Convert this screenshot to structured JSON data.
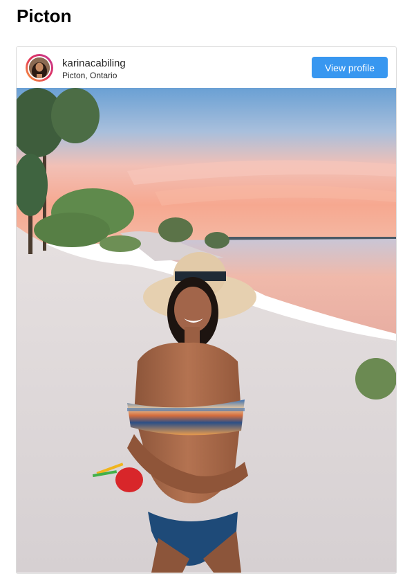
{
  "page": {
    "title": "Picton"
  },
  "post": {
    "username": "karinacabiling",
    "location": "Picton, Ontario",
    "view_profile_label": "View profile",
    "photo_alt": "Photo shared by karinacabiling"
  },
  "colors": {
    "button": "#3897f0",
    "border": "#dbdbdb"
  },
  "icons": {
    "avatar": "profile-picture"
  }
}
